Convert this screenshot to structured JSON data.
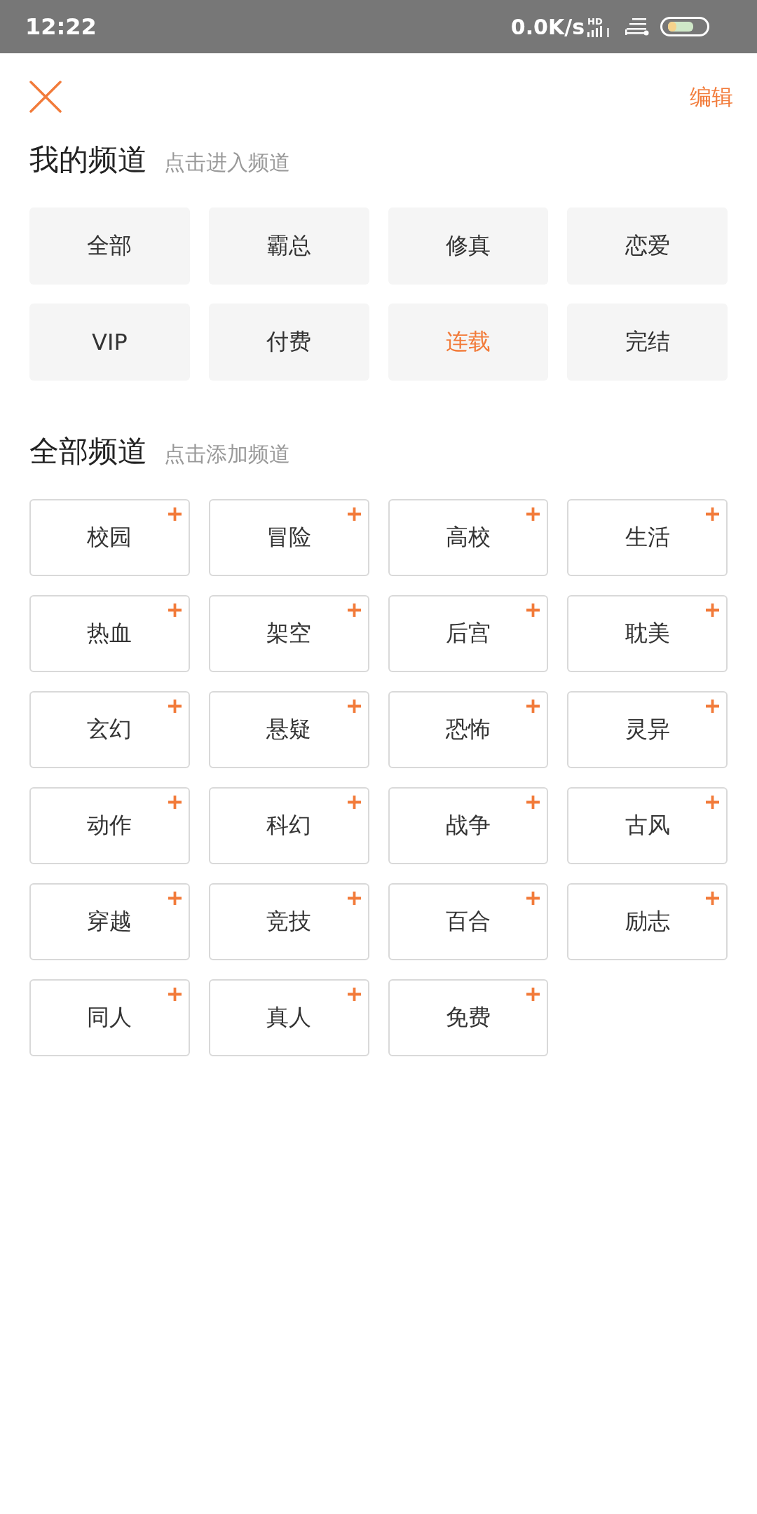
{
  "status_bar": {
    "time": "12:22",
    "network_speed": "0.0K/s",
    "hd_label": "HD"
  },
  "header": {
    "edit_label": "编辑"
  },
  "my_channels": {
    "title": "我的频道",
    "hint": "点击进入频道",
    "items": [
      {
        "label": "全部",
        "selected": false
      },
      {
        "label": "霸总",
        "selected": false
      },
      {
        "label": "修真",
        "selected": false
      },
      {
        "label": "恋爱",
        "selected": false
      },
      {
        "label": "VIP",
        "selected": false
      },
      {
        "label": "付费",
        "selected": false
      },
      {
        "label": "连载",
        "selected": true
      },
      {
        "label": "完结",
        "selected": false
      }
    ]
  },
  "all_channels": {
    "title": "全部频道",
    "hint": "点击添加频道",
    "items": [
      "校园",
      "冒险",
      "高校",
      "生活",
      "热血",
      "架空",
      "后宫",
      "耽美",
      "玄幻",
      "悬疑",
      "恐怖",
      "灵异",
      "动作",
      "科幻",
      "战争",
      "古风",
      "穿越",
      "竞技",
      "百合",
      "励志",
      "同人",
      "真人",
      "免费"
    ]
  }
}
